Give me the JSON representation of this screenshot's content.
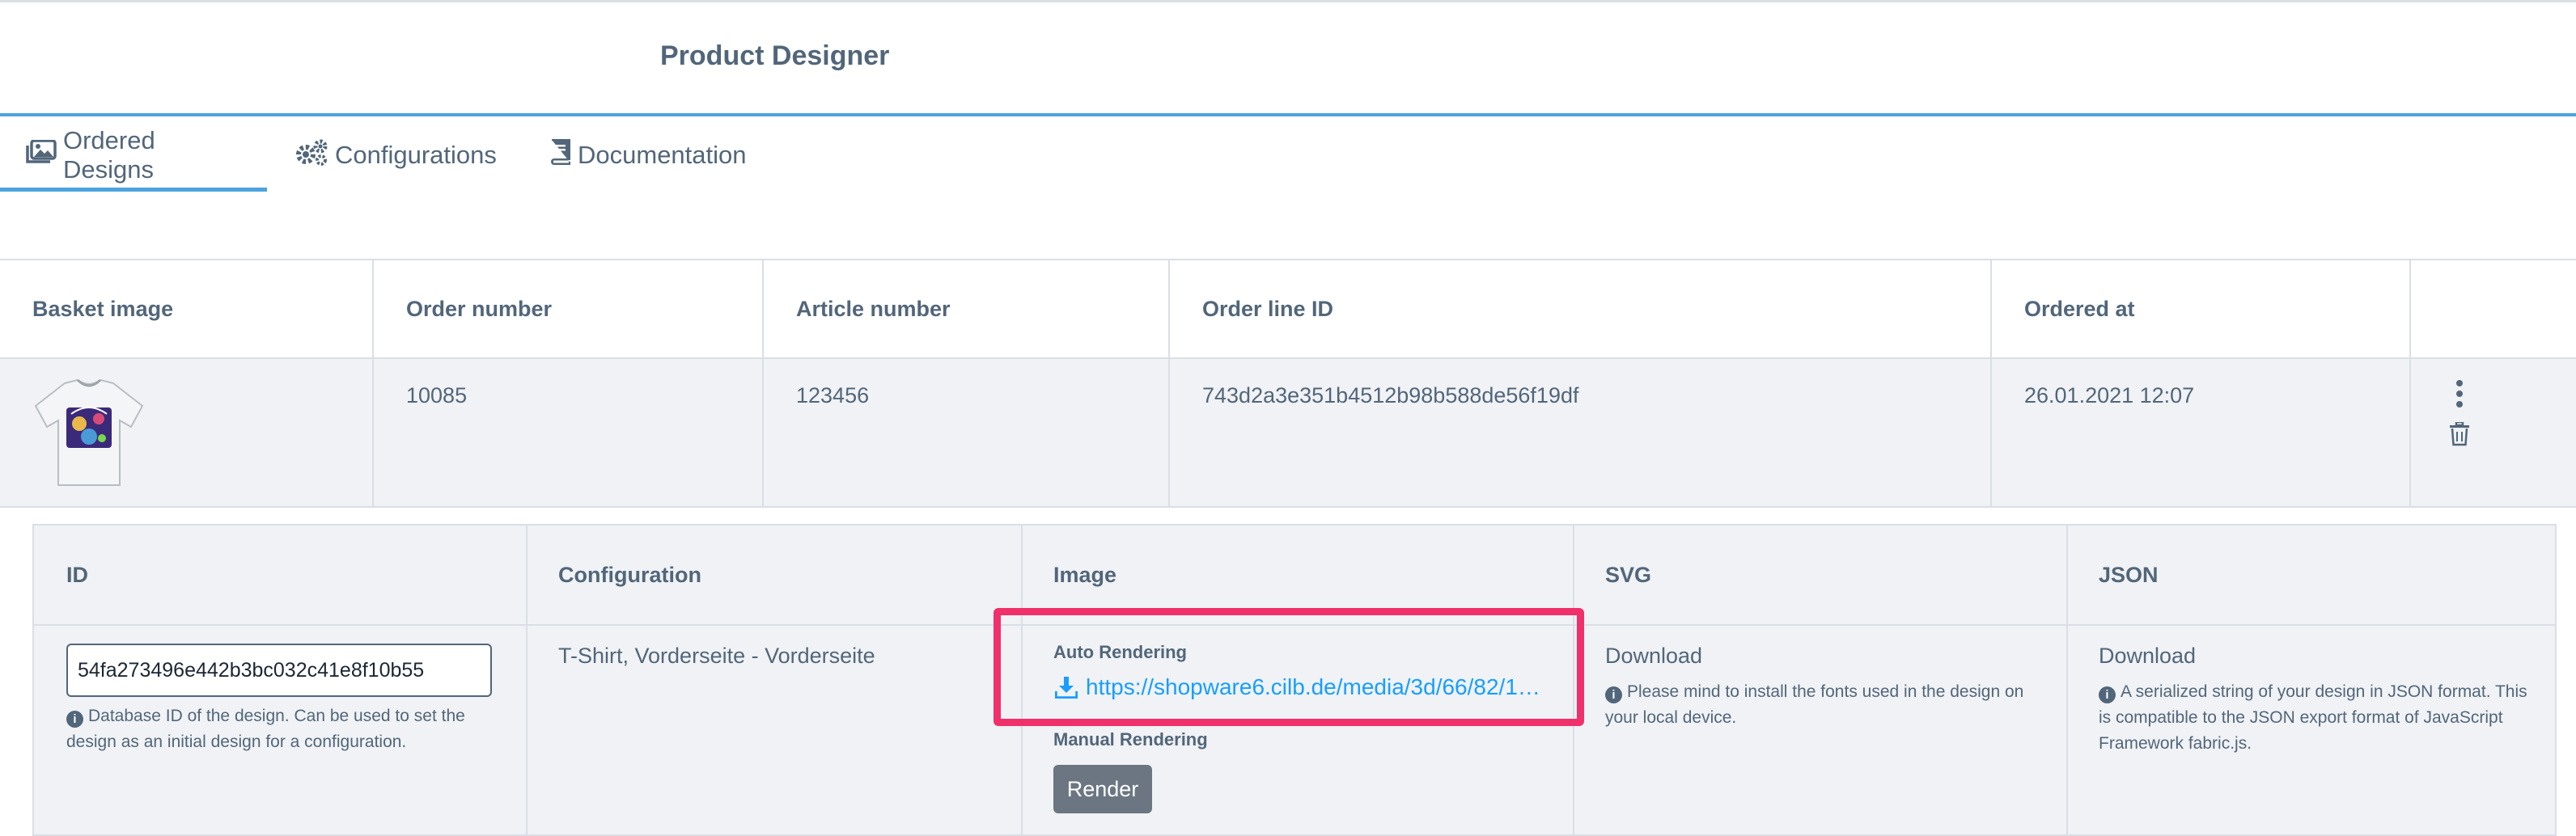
{
  "header": {
    "title": "Product Designer"
  },
  "tabs": [
    {
      "label": "Ordered Designs",
      "icon": "images-icon",
      "active": true
    },
    {
      "label": "Configurations",
      "icon": "cogs-icon",
      "active": false
    },
    {
      "label": "Documentation",
      "icon": "book-icon",
      "active": false
    }
  ],
  "orders_table": {
    "columns": [
      "Basket image",
      "Order number",
      "Article number",
      "Order line ID",
      "Ordered at"
    ],
    "rows": [
      {
        "basket_image": "t-shirt-thumbnail",
        "order_number": "10085",
        "article_number": "123456",
        "order_line_id": "743d2a3e351b4512b98b588de56f19df",
        "ordered_at": "26.01.2021 12:07"
      }
    ]
  },
  "design_table": {
    "columns": [
      "ID",
      "Configuration",
      "Image",
      "SVG",
      "JSON"
    ],
    "row": {
      "id_value": "54fa273496e442b3bc032c41e8f10b55",
      "id_help": "Database ID of the design. Can be used to set the design as an initial design for a configuration.",
      "configuration": "T-Shirt, Vorderseite - Vorderseite",
      "auto_rendering_label": "Auto Rendering",
      "auto_rendering_link": "https://shopware6.cilb.de/media/3d/66/82/1…",
      "manual_rendering_label": "Manual Rendering",
      "render_button": "Render",
      "svg_download": "Download",
      "svg_help": "Please mind to install the fonts used in the design on your local device.",
      "json_download": "Download",
      "json_help": "A serialized string of your design in JSON format. This is compatible to the JSON export format of JavaScript Framework fabric.js."
    }
  },
  "colors": {
    "accent": "#4ca3dd",
    "link": "#189eff",
    "highlight": "#f0306a",
    "text": "#52667a",
    "row_bg": "#f0f2f5",
    "button_bg": "#6b7682"
  }
}
